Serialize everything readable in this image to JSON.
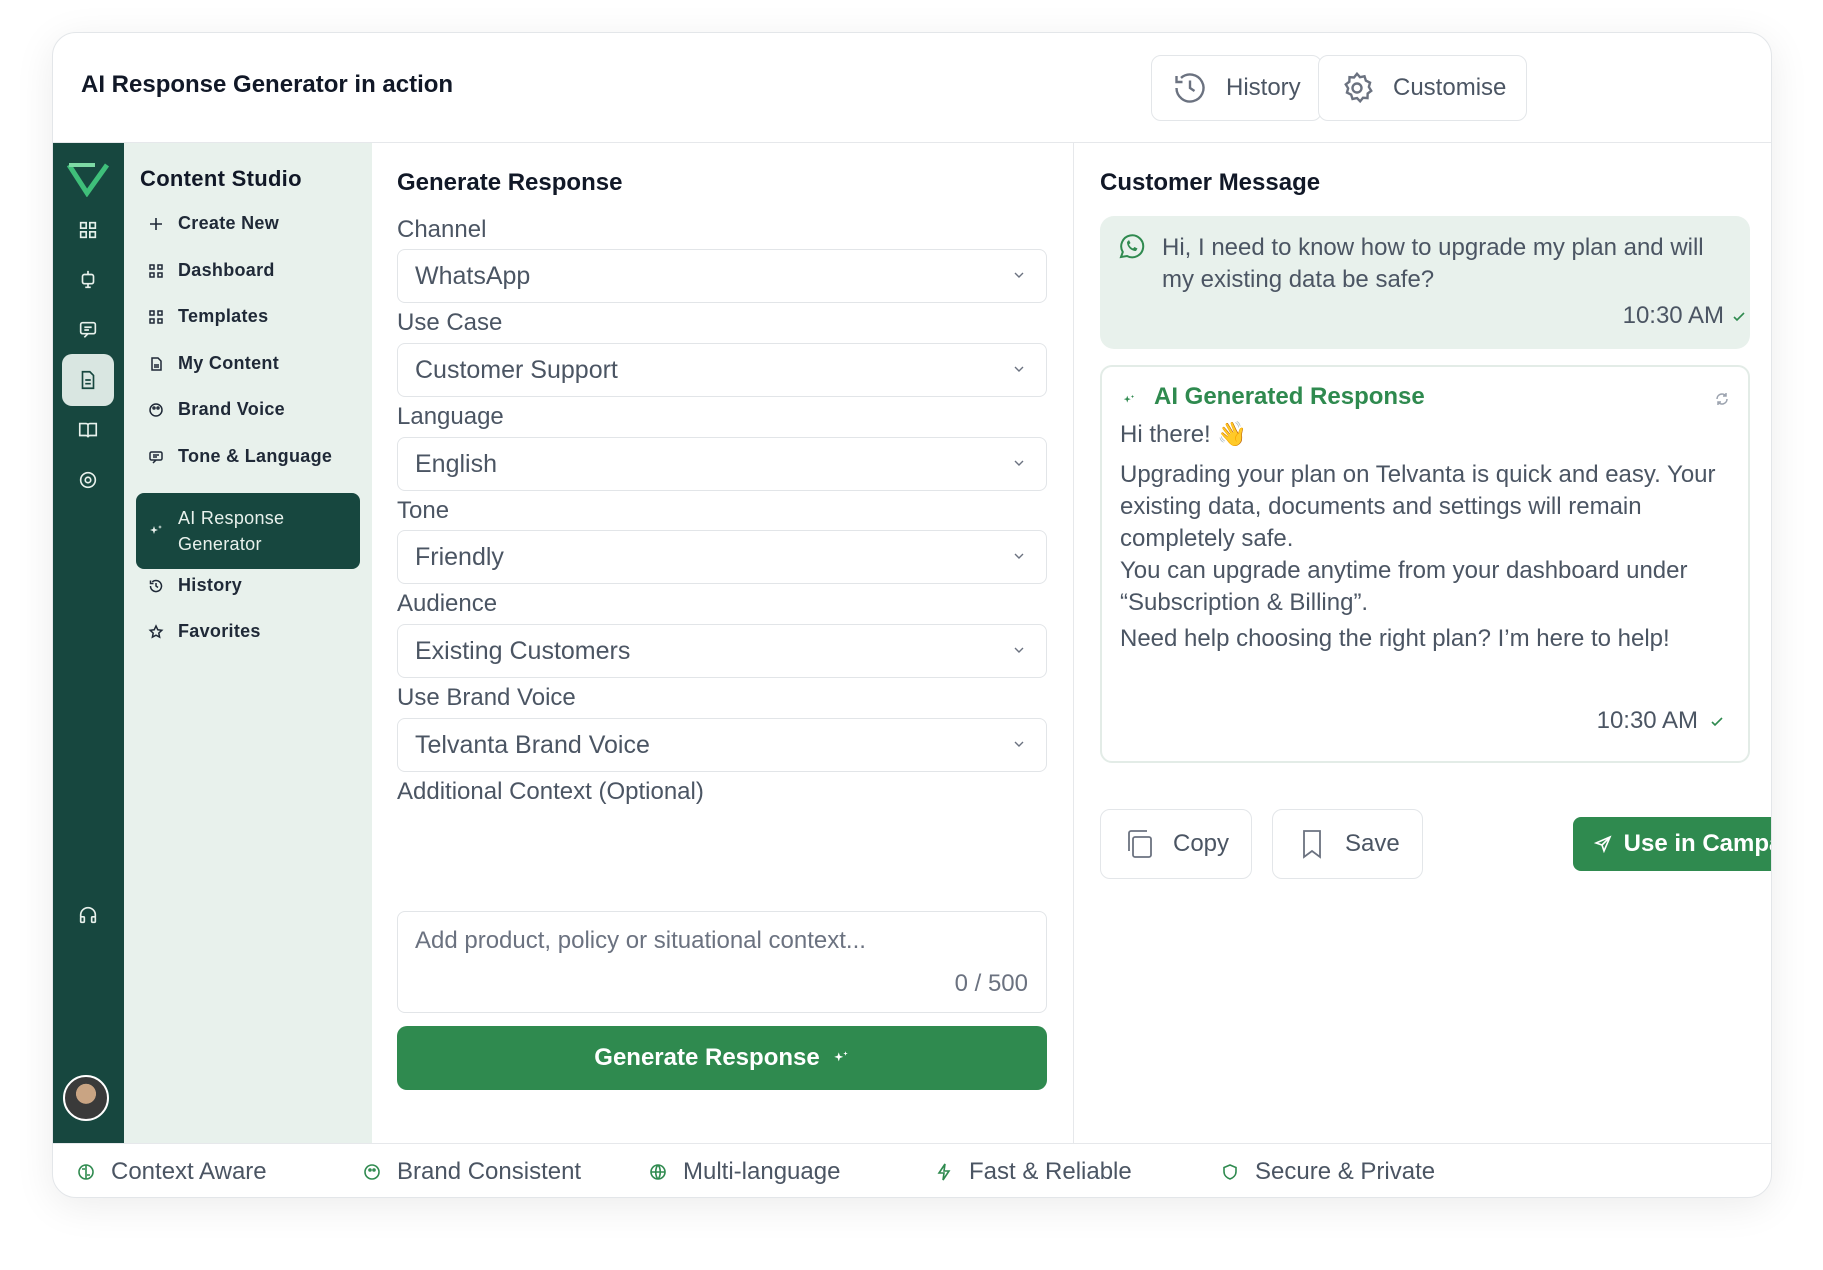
{
  "header": {
    "title": "AI Response Generator in action",
    "history_label": "History",
    "customise_label": "Customise"
  },
  "subnav": {
    "heading": "Content Studio",
    "items": [
      {
        "label": "Create New",
        "icon": "plus-icon"
      },
      {
        "label": "Dashboard",
        "icon": "grid-icon"
      },
      {
        "label": "Templates",
        "icon": "grid-icon"
      },
      {
        "label": "My Content",
        "icon": "document-icon"
      },
      {
        "label": "Brand Voice",
        "icon": "palette-icon"
      },
      {
        "label": "Tone & Language",
        "icon": "chat-icon"
      },
      {
        "label": "AI Response Generator",
        "icon": "sparkle-icon",
        "active": true
      },
      {
        "label": "History",
        "icon": "history-icon"
      },
      {
        "label": "Favorites",
        "icon": "star-icon"
      }
    ]
  },
  "form": {
    "heading": "Generate Response",
    "channel_label": "Channel",
    "channel_value": "WhatsApp",
    "usecase_label": "Use Case",
    "usecase_value": "Customer Support",
    "language_label": "Language",
    "language_value": "English",
    "tone_label": "Tone",
    "tone_value": "Friendly",
    "audience_label": "Audience",
    "audience_value": "Existing Customers",
    "brandvoice_label": "Use Brand Voice",
    "brandvoice_value": "Telvanta Brand Voice",
    "context_label": "Additional Context (Optional)",
    "context_placeholder": "Add product, policy or situational context...",
    "context_count": "0 / 500",
    "generate_label": "Generate Response"
  },
  "customer": {
    "heading": "Customer Message",
    "message": "Hi, I need to know how to upgrade my plan and will my existing data be safe?",
    "time": "10:30 AM"
  },
  "ai_response": {
    "title": "AI Generated Response",
    "greeting": "Hi there! 👋",
    "para1": "Upgrading your plan on Telvanta is quick and easy. Your existing data, documents and settings will remain completely safe.",
    "para2": "You can upgrade anytime from your dashboard under “Subscription & Billing”.",
    "para3": "Need help choosing the right plan? I’m here to help!",
    "time": "10:30 AM"
  },
  "actions": {
    "copy_label": "Copy",
    "save_label": "Save",
    "campaign_label": "Use in Campaign"
  },
  "features": [
    "Context Aware",
    "Brand Consistent",
    "Multi-language",
    "Fast & Reliable",
    "Secure & Private"
  ],
  "colors": {
    "primary_green": "#2f8a4f",
    "rail_dark": "#17473f",
    "subnav_bg": "#e8f1ec"
  }
}
